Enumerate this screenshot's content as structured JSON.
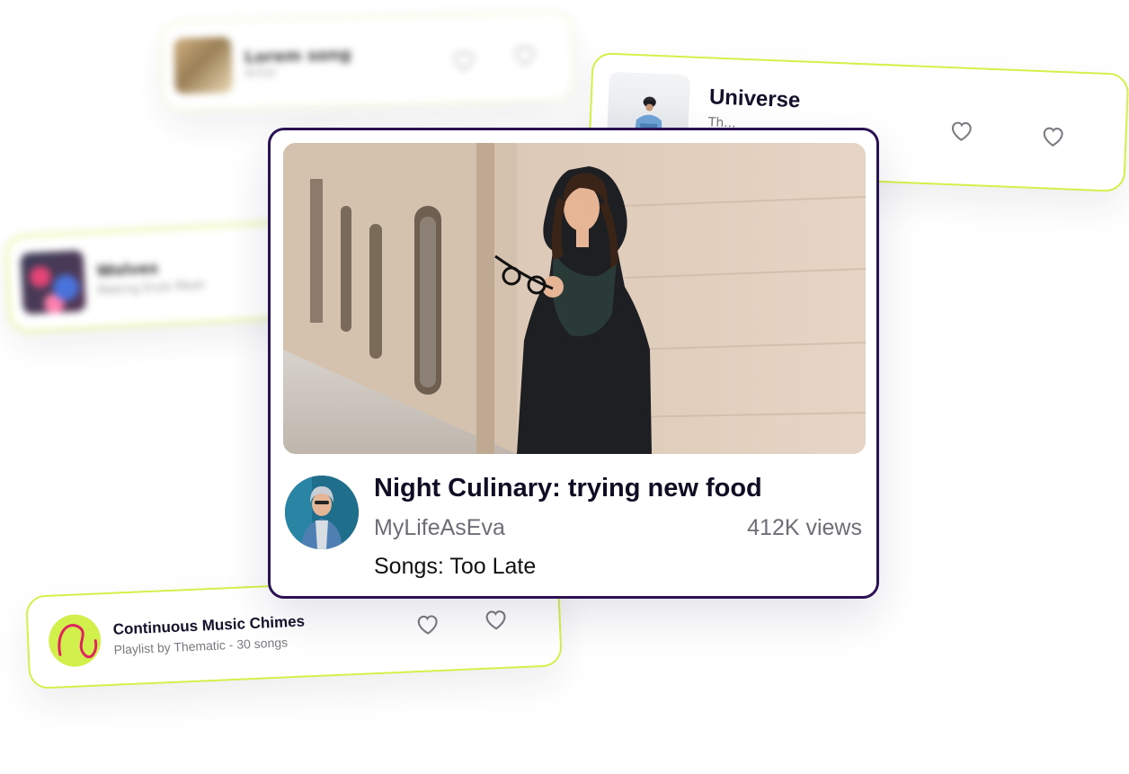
{
  "cards": {
    "top_left": {
      "title": "Lorem song",
      "subtitle": "Artist"
    },
    "middle_left": {
      "title": "Wolves",
      "subtitle": "Making Ends Meet"
    },
    "universe": {
      "title": "Universe",
      "subtitle": "Th..."
    },
    "playlist": {
      "title": "Continuous Music Chimes",
      "subtitle": "Playlist by Thematic - 30 songs"
    }
  },
  "video": {
    "title": "Night Culinary: trying new food",
    "channel": "MyLifeAsEva",
    "views": "412K views",
    "songs_label": "Songs:",
    "songs_value": "Too Late"
  },
  "icons": {
    "like": "heart-outline-icon"
  },
  "colors": {
    "accent_lime": "#d4f04a",
    "main_border": "#2a1255",
    "title_text": "#0f0c24",
    "muted_text": "#6d6d75"
  }
}
